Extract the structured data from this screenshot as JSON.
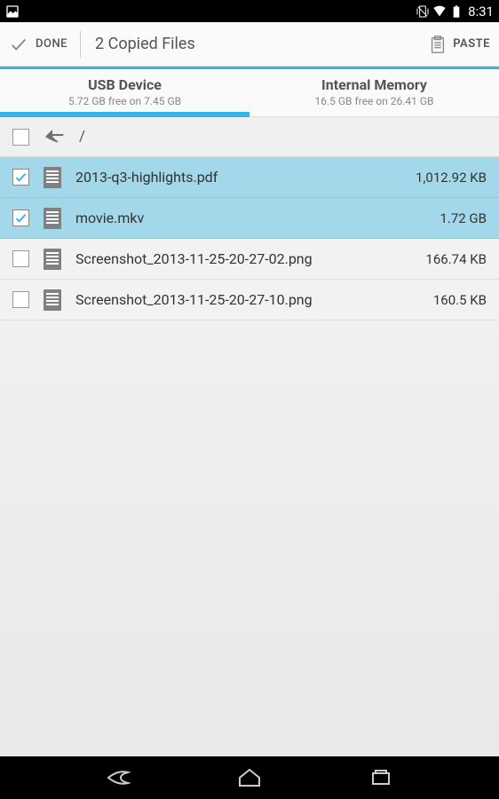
{
  "status": {
    "time": "8:31"
  },
  "actionbar": {
    "done": "DONE",
    "title": "2 Copied Files",
    "paste": "PASTE"
  },
  "tabs": [
    {
      "title": "USB Device",
      "sub": "5.72 GB free on 7.45 GB",
      "active": true
    },
    {
      "title": "Internal Memory",
      "sub": "16.5 GB free on 26.41 GB",
      "active": false
    }
  ],
  "path": "/",
  "files": [
    {
      "name": "2013-q3-highlights.pdf",
      "size": "1,012.92 KB",
      "selected": true
    },
    {
      "name": "movie.mkv",
      "size": "1.72 GB",
      "selected": true
    },
    {
      "name": "Screenshot_2013-11-25-20-27-02.png",
      "size": "166.74 KB",
      "selected": false
    },
    {
      "name": "Screenshot_2013-11-25-20-27-10.png",
      "size": "160.5 KB",
      "selected": false
    }
  ]
}
